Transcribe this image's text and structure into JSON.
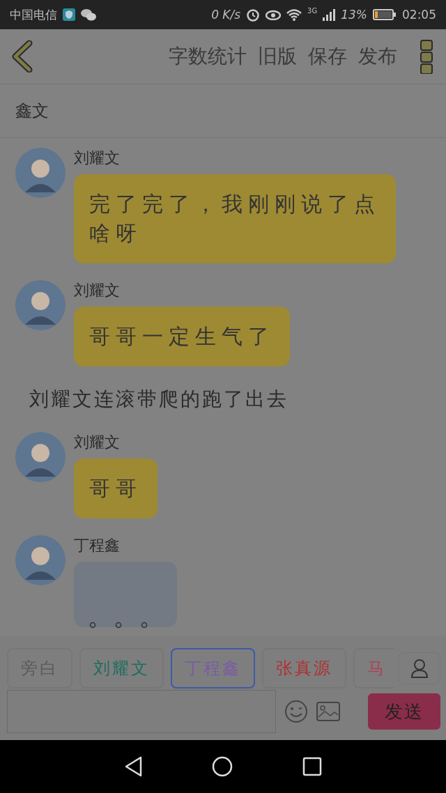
{
  "status_bar": {
    "carrier": "中国电信",
    "speed": "0 K/s",
    "network": "3G",
    "battery": "13%",
    "time": "02:05"
  },
  "header": {
    "actions": [
      "字数统计",
      "旧版",
      "保存",
      "发布"
    ]
  },
  "title": "鑫文",
  "messages": [
    {
      "kind": "message",
      "sender": "刘耀文",
      "text": "完了完了，我刚刚说了点啥呀"
    },
    {
      "kind": "message",
      "sender": "刘耀文",
      "text": "哥哥一定生气了"
    },
    {
      "kind": "narration",
      "text": "刘耀文连滚带爬的跑了出去"
    },
    {
      "kind": "message",
      "sender": "刘耀文",
      "text": "哥哥"
    },
    {
      "kind": "typing",
      "sender": "丁程鑫"
    }
  ],
  "roles": [
    {
      "name": "旁白",
      "color": "#5a5a5a",
      "selected": false
    },
    {
      "name": "刘耀文",
      "color": "#1c6e5e",
      "selected": false
    },
    {
      "name": "丁程鑫",
      "color": "#7a5aa8",
      "selected": true
    },
    {
      "name": "张真源",
      "color": "#b03030",
      "selected": false
    },
    {
      "name": "马",
      "color": "#b04058",
      "selected": false
    }
  ],
  "composer": {
    "send": "发送"
  }
}
